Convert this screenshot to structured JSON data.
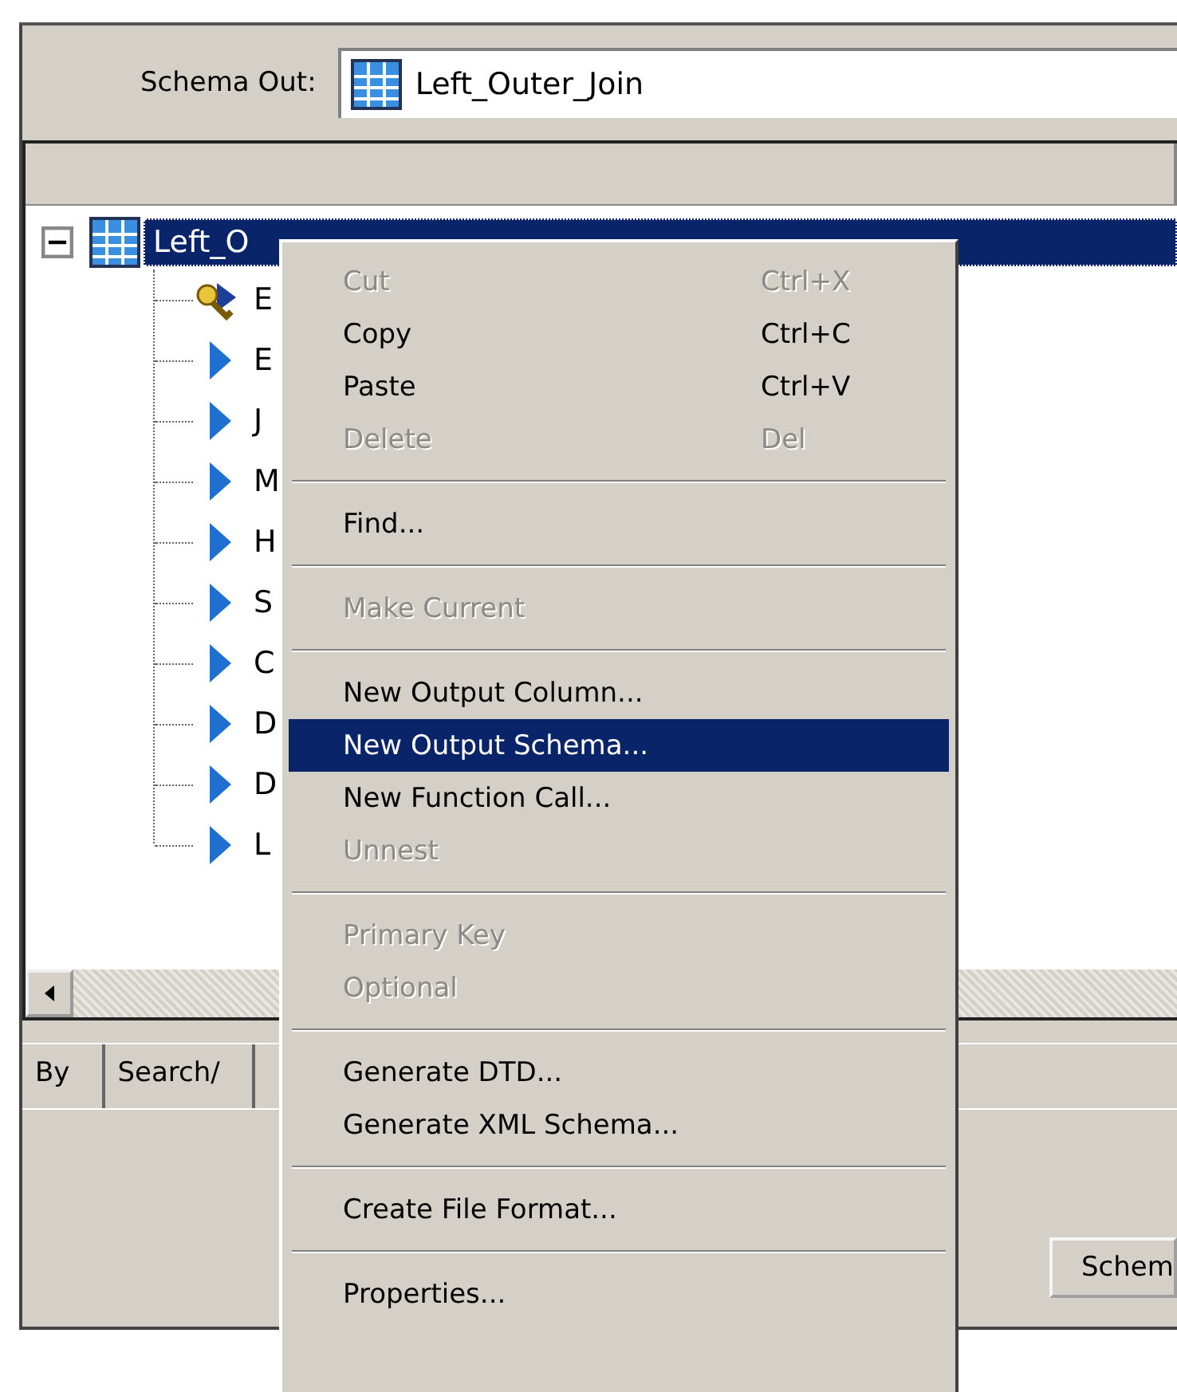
{
  "schema_out": {
    "label": "Schema Out:",
    "value": "Left_Outer_Join"
  },
  "tree": {
    "root": {
      "label": "Left_O",
      "expanded": true,
      "selected": true,
      "children": [
        {
          "label": "E",
          "kind": "key"
        },
        {
          "label": "E",
          "kind": "column"
        },
        {
          "label": "J",
          "kind": "column"
        },
        {
          "label": "M",
          "kind": "column"
        },
        {
          "label": "H",
          "kind": "column"
        },
        {
          "label": "S",
          "kind": "column"
        },
        {
          "label": "C",
          "kind": "column"
        },
        {
          "label": "D",
          "kind": "column"
        },
        {
          "label": "D",
          "kind": "column"
        },
        {
          "label": "L",
          "kind": "column"
        }
      ]
    }
  },
  "tabs": [
    {
      "label": "By",
      "selected": false
    },
    {
      "label": "Search/",
      "selected": false
    }
  ],
  "buttons": [
    "Schem"
  ],
  "context_menu": [
    {
      "kind": "item",
      "label": "Cut",
      "shortcut": "Ctrl+X",
      "disabled": true,
      "selected": false
    },
    {
      "kind": "item",
      "label": "Copy",
      "shortcut": "Ctrl+C",
      "disabled": false,
      "selected": false
    },
    {
      "kind": "item",
      "label": "Paste",
      "shortcut": "Ctrl+V",
      "disabled": false,
      "selected": false
    },
    {
      "kind": "item",
      "label": "Delete",
      "shortcut": "Del",
      "disabled": true,
      "selected": false
    },
    {
      "kind": "separator"
    },
    {
      "kind": "item",
      "label": "Find...",
      "disabled": false,
      "selected": false
    },
    {
      "kind": "separator"
    },
    {
      "kind": "item",
      "label": "Make Current",
      "disabled": true,
      "selected": false
    },
    {
      "kind": "separator"
    },
    {
      "kind": "item",
      "label": "New Output Column...",
      "disabled": false,
      "selected": false
    },
    {
      "kind": "item",
      "label": "New Output Schema...",
      "disabled": false,
      "selected": true
    },
    {
      "kind": "item",
      "label": "New Function Call...",
      "disabled": false,
      "selected": false
    },
    {
      "kind": "item",
      "label": "Unnest",
      "disabled": true,
      "selected": false
    },
    {
      "kind": "separator"
    },
    {
      "kind": "item",
      "label": "Primary Key",
      "disabled": true,
      "selected": false
    },
    {
      "kind": "item",
      "label": "Optional",
      "disabled": true,
      "selected": false
    },
    {
      "kind": "separator"
    },
    {
      "kind": "item",
      "label": "Generate DTD...",
      "disabled": false,
      "selected": false
    },
    {
      "kind": "item",
      "label": "Generate XML Schema...",
      "disabled": false,
      "selected": false
    },
    {
      "kind": "separator"
    },
    {
      "kind": "item",
      "label": "Create File Format...",
      "disabled": false,
      "selected": false
    },
    {
      "kind": "separator"
    },
    {
      "kind": "item",
      "label": "Properties...",
      "disabled": false,
      "selected": false
    }
  ]
}
